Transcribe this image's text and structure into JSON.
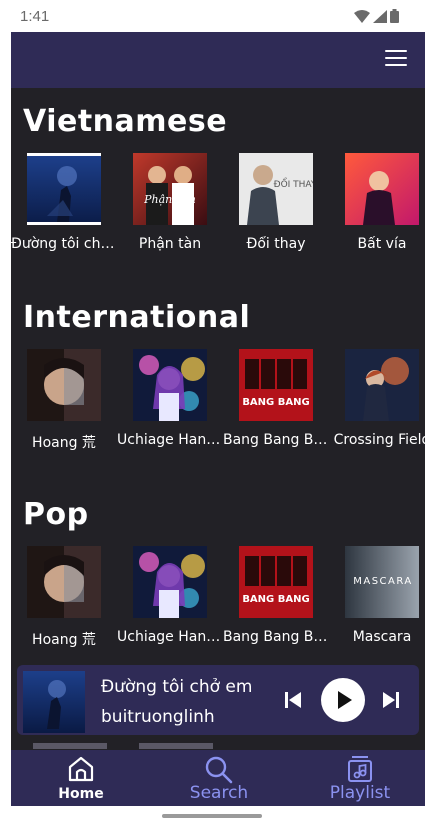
{
  "status_bar": {
    "time": "1:41"
  },
  "colors": {
    "appbar": "#2f2b56",
    "background": "#222126",
    "accent": "#8b92f0",
    "text": "#ffffff"
  },
  "sections": [
    {
      "title": "Vietnamese",
      "items": [
        {
          "label": "Đường tôi chở em"
        },
        {
          "label": "Phận tàn"
        },
        {
          "label": "Đổi thay"
        },
        {
          "label": "Bất vía"
        }
      ]
    },
    {
      "title": "International",
      "items": [
        {
          "label": "Hoang 荒"
        },
        {
          "label": "Uchiage Hanabi"
        },
        {
          "label": "Bang Bang Bang"
        },
        {
          "label": "Crossing Field"
        }
      ]
    },
    {
      "title": "Pop",
      "items": [
        {
          "label": "Hoang 荒"
        },
        {
          "label": "Uchiage Hanabi"
        },
        {
          "label": "Bang Bang Bang"
        },
        {
          "label": "Mascara"
        }
      ]
    }
  ],
  "album_art_text": {
    "phan_tan": "Phận Tàn",
    "doi_thay": "ĐỔI THAY",
    "mascara": "MASCARA",
    "bang_bang": "BANG BANG"
  },
  "now_playing": {
    "title": "Đường tôi chở em",
    "artist": "buitruonglinh"
  },
  "bottom_nav": {
    "items": [
      {
        "label": "Home",
        "icon": "home-icon",
        "active": true
      },
      {
        "label": "Search",
        "icon": "search-icon",
        "active": false
      },
      {
        "label": "Playlist",
        "icon": "playlist-icon",
        "active": false
      }
    ]
  }
}
